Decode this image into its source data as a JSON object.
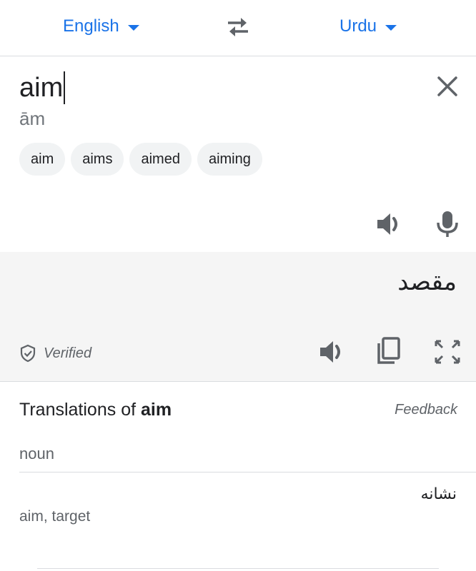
{
  "header": {
    "source_language": "English",
    "target_language": "Urdu",
    "swap_icon": "swap-arrows-icon",
    "accent_color": "#1a73e8"
  },
  "input": {
    "text": "aim",
    "transliteration": "ām",
    "suggestions": [
      "aim",
      "aims",
      "aimed",
      "aiming"
    ],
    "clear_icon": "close-icon",
    "speak_icon": "speaker-icon",
    "mic_icon": "microphone-icon"
  },
  "output": {
    "text": "مقصد",
    "verified_label": "Verified",
    "verified_icon": "shield-check-icon",
    "speak_icon": "speaker-icon",
    "copy_icon": "copy-icon",
    "fullscreen_icon": "fullscreen-icon",
    "background": "#f5f5f5"
  },
  "translations": {
    "heading_prefix": "Translations of",
    "heading_term": "aim",
    "feedback_label": "Feedback",
    "part_of_speech": "noun",
    "entries": [
      {
        "translation": "نشانه",
        "back_translations": "aim, target"
      }
    ]
  }
}
